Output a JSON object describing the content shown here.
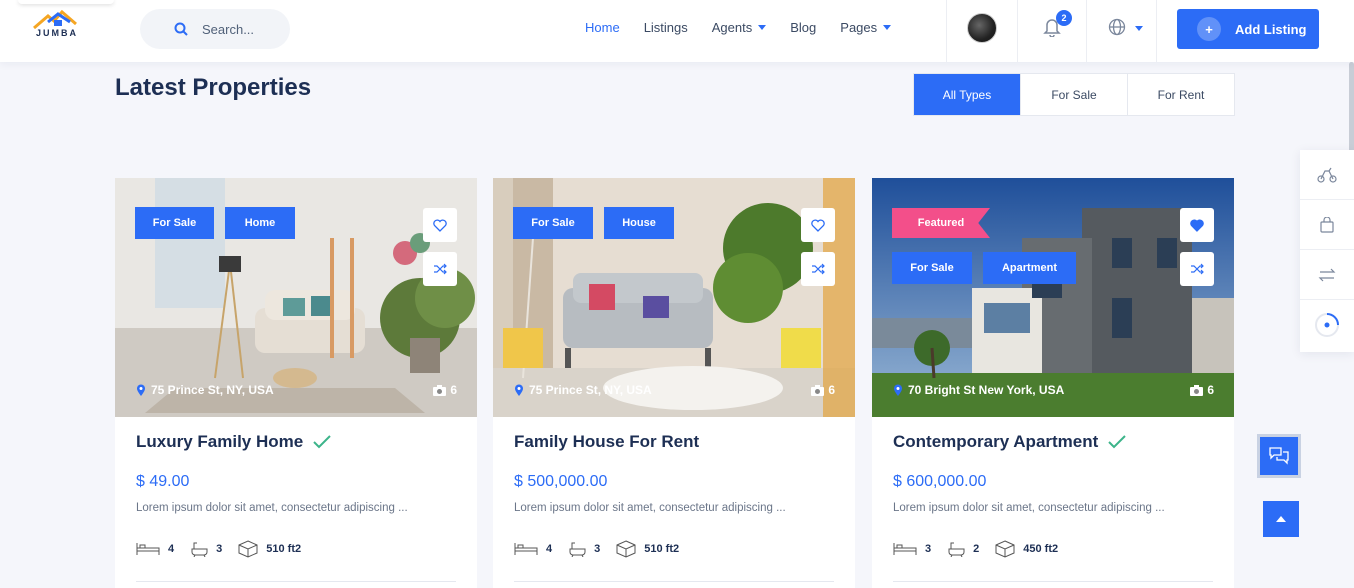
{
  "header": {
    "logo_text": "JUMBA",
    "search_placeholder": "Search...",
    "nav": [
      {
        "label": "Home",
        "active": true
      },
      {
        "label": "Listings"
      },
      {
        "label": "Agents",
        "dropdown": true
      },
      {
        "label": "Blog"
      },
      {
        "label": "Pages",
        "dropdown": true
      }
    ],
    "notification_count": "2",
    "add_listing_label": "Add Listing"
  },
  "section": {
    "title": "Latest Properties",
    "filters": [
      "All Types",
      "For Sale",
      "For Rent"
    ],
    "active_filter": "All Types"
  },
  "cards": [
    {
      "tags": [
        "For Sale",
        "Home"
      ],
      "featured": "",
      "favorited": false,
      "location": "75 Prince St, NY, USA",
      "photos": "6",
      "title": "Luxury Family Home",
      "verified": true,
      "price": "$ 49.00",
      "desc": "Lorem ipsum dolor sit amet, consectetur adipiscing ...",
      "beds": "4",
      "baths": "3",
      "area": "510 ft2"
    },
    {
      "tags": [
        "For Sale",
        "House"
      ],
      "featured": "",
      "favorited": false,
      "location": "75 Prince St, NY, USA",
      "photos": "6",
      "title": "Family House For Rent",
      "verified": false,
      "price": "$ 500,000.00",
      "desc": "Lorem ipsum dolor sit amet, consectetur adipiscing ...",
      "beds": "4",
      "baths": "3",
      "area": "510 ft2"
    },
    {
      "tags": [
        "For Sale",
        "Apartment"
      ],
      "featured": "Featured",
      "favorited": true,
      "location": "70 Bright St New York, USA",
      "photos": "6",
      "title": "Contemporary Apartment",
      "verified": true,
      "price": "$ 600,000.00",
      "desc": "Lorem ipsum dolor sit amet, consectetur adipiscing ...",
      "beds": "3",
      "baths": "2",
      "area": "450 ft2"
    }
  ],
  "sidebar_icons": [
    "scooter-icon",
    "bag-icon",
    "compare-icon",
    "loading-spinner-icon"
  ],
  "colors": {
    "accent": "#2c6cf6",
    "featured": "#f34f8a",
    "verified": "#3cb48a",
    "text": "#1d2f54"
  }
}
